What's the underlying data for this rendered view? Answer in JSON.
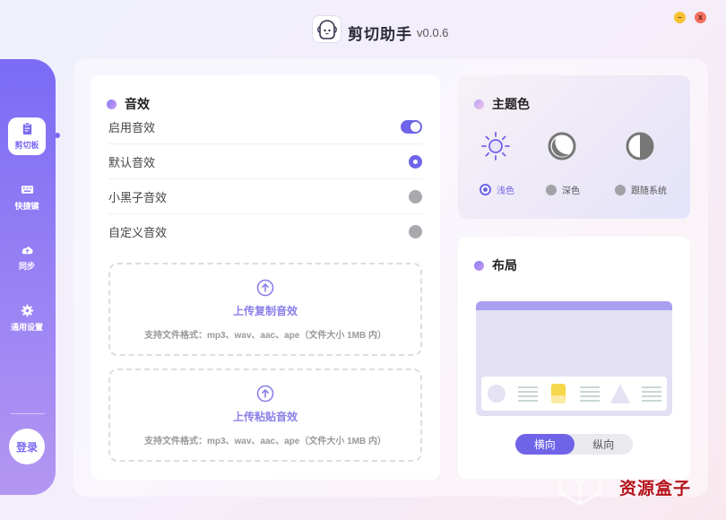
{
  "app": {
    "title": "剪切助手",
    "version": "v0.0.6"
  },
  "window_controls": {
    "minimize": "–",
    "close": "x"
  },
  "sidebar": {
    "items": [
      {
        "label": "剪切板",
        "icon": "clipboard-icon",
        "active": true
      },
      {
        "label": "快捷键",
        "icon": "keyboard-icon",
        "active": false
      },
      {
        "label": "同步",
        "icon": "cloud-upload-icon",
        "active": false
      },
      {
        "label": "通用设置",
        "icon": "gear-icon",
        "active": false
      }
    ],
    "login_label": "登录"
  },
  "sound": {
    "title": "音效",
    "rows": [
      {
        "label": "启用音效",
        "control": "toggle",
        "on": true
      },
      {
        "label": "默认音效",
        "control": "radio",
        "selected": true
      },
      {
        "label": "小黑子音效",
        "control": "radio",
        "selected": false
      },
      {
        "label": "自定义音效",
        "control": "radio",
        "selected": false
      }
    ],
    "uploads": [
      {
        "label": "上传复制音效",
        "hint": "支持文件格式：mp3、wav、aac、ape（文件大小 1MB 内）"
      },
      {
        "label": "上传粘贴音效",
        "hint": "支持文件格式：mp3、wav、aac、ape（文件大小 1MB 内）"
      }
    ]
  },
  "theme": {
    "title": "主题色",
    "options": [
      {
        "label": "浅色",
        "icon": "sun-icon",
        "selected": true
      },
      {
        "label": "深色",
        "icon": "moon-icon",
        "selected": false
      },
      {
        "label": "跟随系统",
        "icon": "half-circle-icon",
        "selected": false
      }
    ]
  },
  "layout": {
    "title": "布局",
    "options": [
      {
        "label": "横向",
        "selected": true
      },
      {
        "label": "纵向",
        "selected": false
      }
    ]
  },
  "watermark": {
    "big": "资源",
    "small": "资源盒子"
  },
  "colors": {
    "accent": "#6f64e8",
    "sidebar_top": "#7b6bf5",
    "sidebar_bottom": "#b497f2"
  }
}
